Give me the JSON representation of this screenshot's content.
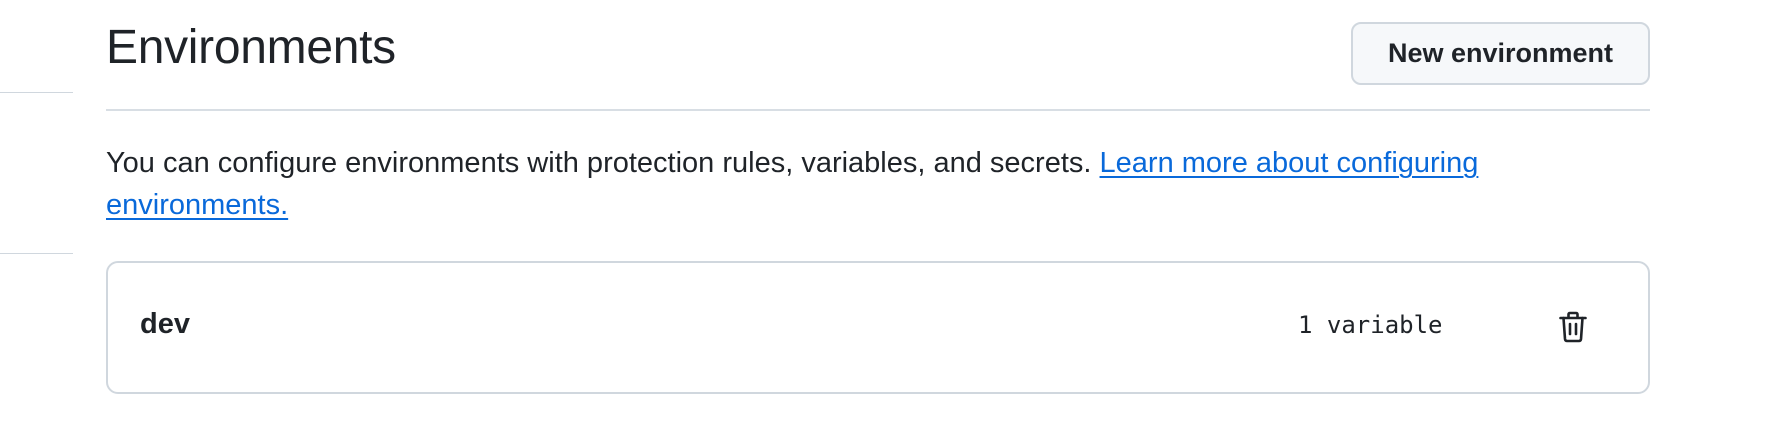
{
  "header": {
    "title": "Environments",
    "new_button_label": "New environment"
  },
  "description": {
    "text": "You can configure environments with protection rules, variables, and secrets. ",
    "link_text": "Learn more about configuring environments."
  },
  "environments": [
    {
      "name": "dev",
      "variables": "1 variable",
      "delete_icon": "trash-icon"
    }
  ],
  "colors": {
    "link": "#0969da",
    "text": "#1f2328",
    "border": "#d0d7de",
    "button_bg": "#f6f8fa"
  }
}
